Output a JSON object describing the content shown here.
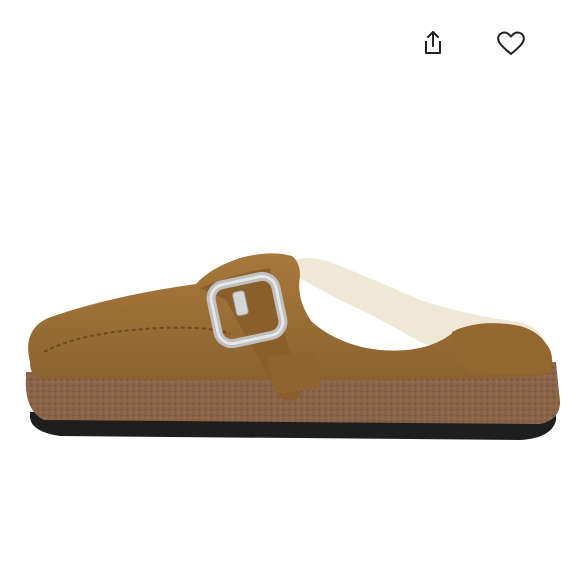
{
  "actions": {
    "share_icon": "share-icon",
    "like_icon": "heart-icon"
  },
  "product": {
    "image": "brown-suede-shearling-clog-with-buckle"
  },
  "colors": {
    "background": "#ffffff",
    "icon": "#222222",
    "suede": "#9a6d33",
    "suede_dark": "#7a5226",
    "cork": "#8a6448",
    "sole": "#1e1e1e",
    "shearling": "#efe8d6",
    "buckle": "#c9c9c9"
  }
}
